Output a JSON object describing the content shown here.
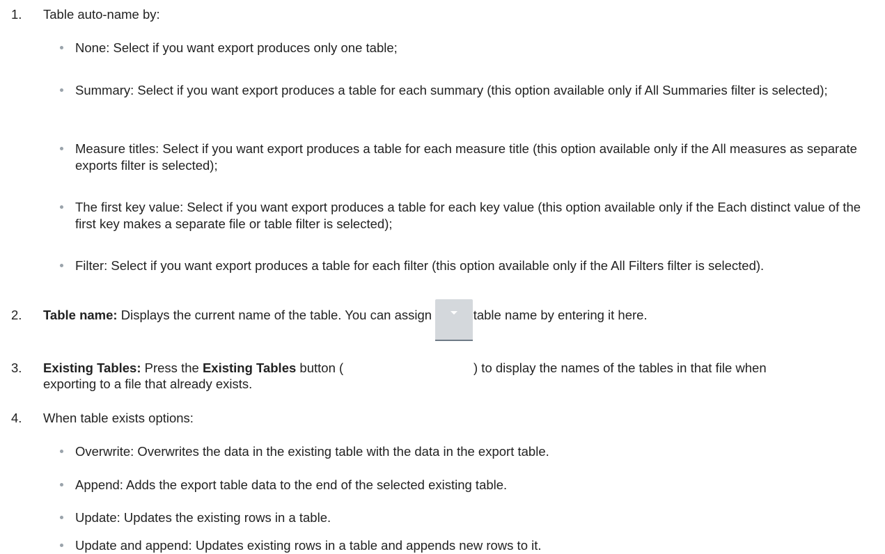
{
  "items": [
    {
      "number": "1.",
      "text": "Table auto-name by:"
    },
    {
      "number": "2.",
      "label": "Table name:",
      "text": " Displays the current name of the table. You can assign a new table name by entering it here."
    },
    {
      "number": "3.",
      "label": "Existing Tables:",
      "text_a": " Press the ",
      "label_b": "Existing Tables",
      "text_b": " button (",
      "text_c": ") to display the names of the tables in that file when",
      "text_d": "exporting to a file that already exists."
    },
    {
      "number": "4.",
      "text": "When table exists options:"
    }
  ],
  "auto_name_bullets": [
    "None: Select if you want export produces only one table;",
    "Summary: Select if you want export produces a table for each summary (this option available only if All Summaries filter is selected);",
    "Measure titles: Select if you want export produces a table for each measure title (this option available only if the All measures as separate exports filter is selected);",
    "The first key value: Select if you want export produces a table for each key value (this option available only if the Each distinct value of the first key makes a separate file or table filter is selected);",
    "Filter: Select if you want export produces a table for each filter (this option available only if the All Filters filter is selected)."
  ],
  "exists_bullets": [
    "Overwrite: Overwrites the data in the existing table with the data in the export table.",
    "Append: Adds the export table data to the end of the selected existing table.",
    "Update: Updates the existing rows in a table.",
    "Update and append: Updates existing rows in a table and appends new rows to it."
  ],
  "icons": {
    "existing_tables_button": "dropdown-arrow-icon"
  }
}
